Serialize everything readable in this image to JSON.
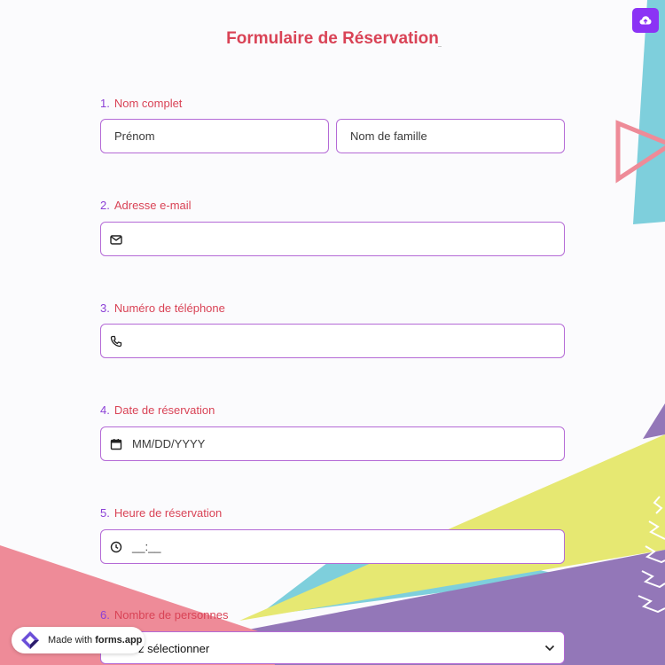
{
  "form": {
    "title": "Formulaire de Réservation",
    "upload_icon": "cloud-upload-icon"
  },
  "questions": [
    {
      "number": "1.",
      "label": "Nom complet"
    },
    {
      "number": "2.",
      "label": "Adresse e-mail"
    },
    {
      "number": "3.",
      "label": "Numéro de téléphone"
    },
    {
      "number": "4.",
      "label": "Date de réservation"
    },
    {
      "number": "5.",
      "label": "Heure de réservation"
    },
    {
      "number": "6.",
      "label": "Nombre de personnes"
    }
  ],
  "fields": {
    "first_name_placeholder": "Prénom",
    "last_name_placeholder": "Nom de famille",
    "email_icon": "envelope-icon",
    "phone_icon": "phone-icon",
    "date_icon": "calendar-icon",
    "date_placeholder": "MM/DD/YYYY",
    "time_icon": "clock-icon",
    "time_placeholder": "__:__",
    "persons_placeholder": "z sélectionner",
    "persons_icon": "chevron-down-icon"
  },
  "branding": {
    "made_with": "Made with",
    "brand": "forms.app"
  },
  "colors": {
    "accent": "#d94356",
    "number": "#8b3fd6",
    "border": "#b46ad6",
    "button": "#8b33f5",
    "cyan": "#7ecfdc",
    "pink": "#ee8b98",
    "yellow": "#e6e872",
    "purple": "#9377b8"
  }
}
